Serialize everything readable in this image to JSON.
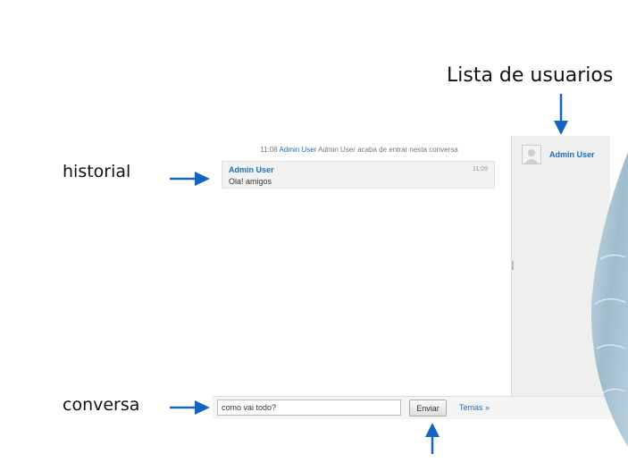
{
  "annotations": {
    "title": "Lista de usuarios",
    "history": "historial",
    "conversation": "conversa"
  },
  "chat": {
    "system_message": {
      "time": "11:08",
      "user": "Admin User",
      "text": "Admin User acaba de entrar nesta conversa"
    },
    "messages": [
      {
        "author": "Admin User",
        "time": "11:09",
        "text": "Ola! amigos"
      }
    ]
  },
  "users": [
    {
      "name": "Admin User"
    }
  ],
  "composer": {
    "input_value": "como vai todo?",
    "send_label": "Enviar",
    "themes_label": "Temas »"
  },
  "colors": {
    "link_blue": "#1f6fb2",
    "arrow_blue": "#1565c0"
  },
  "icons": {
    "avatar": "user-avatar-icon",
    "arrow": "arrow-icon"
  }
}
